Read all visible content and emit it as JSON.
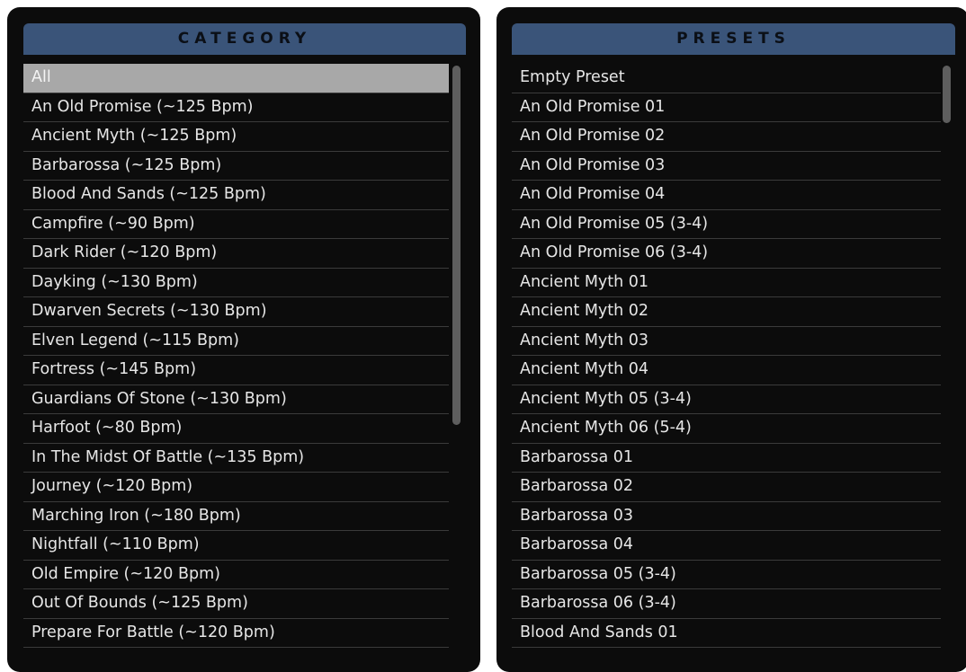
{
  "category": {
    "title": "CATEGORY",
    "selected_index": 0,
    "items": [
      "All",
      "An Old Promise (~125 Bpm)",
      "Ancient Myth (~125 Bpm)",
      "Barbarossa (~125 Bpm)",
      "Blood And Sands (~125 Bpm)",
      "Campfire (~90 Bpm)",
      "Dark Rider (~120 Bpm)",
      "Dayking (~130 Bpm)",
      "Dwarven Secrets (~130 Bpm)",
      "Elven Legend (~115 Bpm)",
      "Fortress (~145 Bpm)",
      "Guardians Of Stone (~130 Bpm)",
      "Harfoot (~80 Bpm)",
      "In The Midst Of Battle (~135 Bpm)",
      "Journey (~120 Bpm)",
      "Marching Iron (~180 Bpm)",
      "Nightfall (~110 Bpm)",
      "Old Empire (~120 Bpm)",
      "Out Of Bounds (~125 Bpm)",
      "Prepare For Battle (~120 Bpm)"
    ]
  },
  "presets": {
    "title": "PRESETS",
    "items": [
      "Empty Preset",
      "An Old Promise 01",
      "An Old Promise 02",
      "An Old Promise 03",
      "An Old Promise 04",
      "An Old Promise 05 (3-4)",
      "An Old Promise 06 (3-4)",
      "Ancient Myth 01",
      "Ancient Myth 02",
      "Ancient Myth 03",
      "Ancient Myth 04",
      "Ancient Myth 05 (3-4)",
      "Ancient Myth 06 (5-4)",
      "Barbarossa 01",
      "Barbarossa 02",
      "Barbarossa 03",
      "Barbarossa 04",
      "Barbarossa 05 (3-4)",
      "Barbarossa 06 (3-4)",
      "Blood And Sands 01"
    ]
  },
  "colors": {
    "panel_background": "#0c0c0c",
    "header_background": "#3a5479",
    "selected_row": "#a8a8a8",
    "row_text": "#e6e6e6",
    "row_divider": "#3b3b3b",
    "scrollbar_thumb": "#5e5e5e"
  }
}
